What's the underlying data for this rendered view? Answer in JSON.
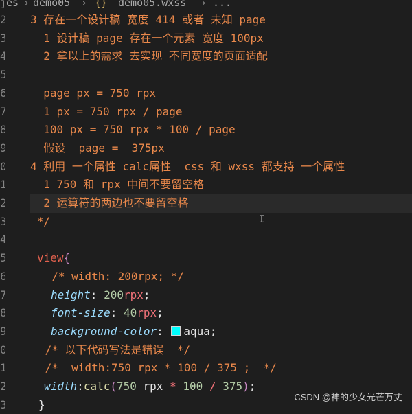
{
  "breadcrumb": {
    "items": [
      "jes",
      "demo05",
      "demo05.wxss",
      "..."
    ],
    "separators": [
      "›",
      "›",
      "›"
    ],
    "file_icon": "braces-icon"
  },
  "gutter": {
    "line_numbers": [
      "2",
      "3",
      "4",
      "5",
      "6",
      "7",
      "8",
      "9",
      "0",
      "1",
      "2",
      "3",
      "4",
      "5",
      "6",
      "7",
      "8",
      "9",
      "0",
      "1",
      "2",
      "3"
    ]
  },
  "code": {
    "l1": "3 存在一个设计稿 宽度 414 或者 未知 page",
    "l2": "  1 设计稿 page 存在一个元素 宽度 100px",
    "l3": "  2 拿以上的需求 去实现 不同宽度的页面适配",
    "l4": "",
    "l5": "  page px = 750 rpx",
    "l6": "  1 px = 750 rpx / page",
    "l7": "  100 px = 750 rpx * 100 / page",
    "l8": "  假设  page =  375px",
    "l9": "4 利用 一个属性 calc属性  css 和 wxss 都支持 一个属性",
    "l10": "  1 750 和 rpx 中间不要留空格",
    "l11": "  2 运算符的两边也不要留空格",
    "l12": " */",
    "l13": "",
    "selector": "view",
    "brace_open": "{",
    "comment_width": "  /* width: 200rpx; */",
    "height_prop": "height",
    "height_num": "200",
    "height_unit": "rpx",
    "fontsize_prop": "font-size",
    "fontsize_num": "40",
    "fontsize_unit": "rpx",
    "bg_prop": "background-color",
    "bg_value": "aqua",
    "comment_wrong": " /* 以下代码写法是错误  */",
    "comment_calc": " /*  width:750 rpx * 100 / 375 ;  */",
    "width_prop": "width",
    "calc_fn": "calc",
    "calc_a": "750",
    "calc_unit": "rpx",
    "calc_op1": "*",
    "calc_b": "100",
    "calc_op2": "/",
    "calc_c": "375",
    "brace_close": "}"
  },
  "watermark": "CSDN @神的少女光芒万丈",
  "colors": {
    "background": "#1e1e1e",
    "comment": "#e9884b",
    "selector": "#e2614e",
    "swatch": "#00ffff"
  }
}
